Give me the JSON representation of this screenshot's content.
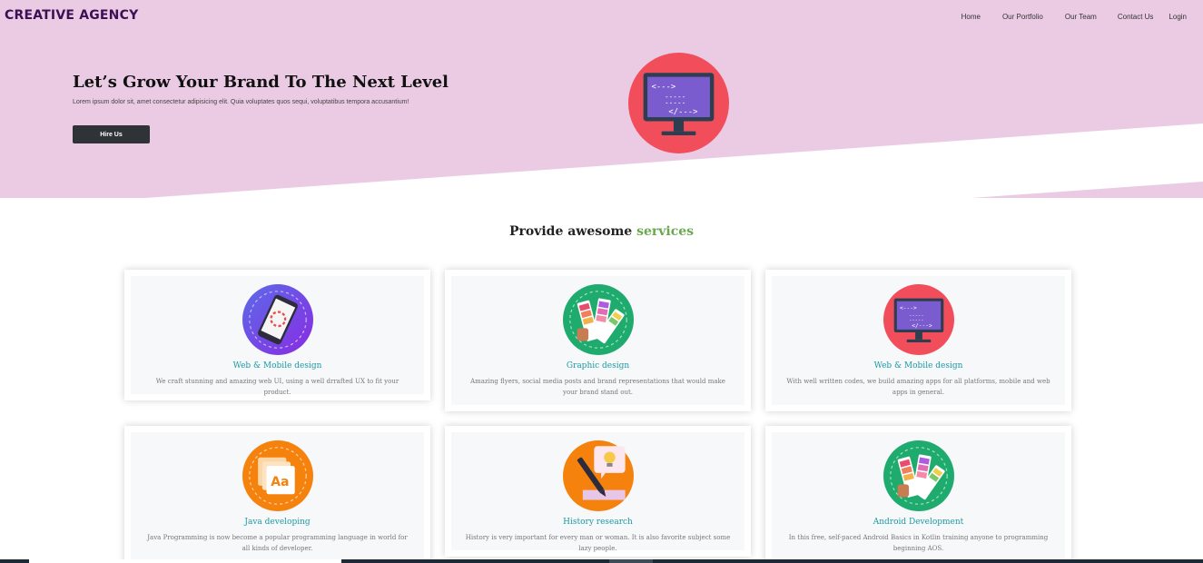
{
  "header": {
    "brand": "CREATIVE AGENCY",
    "nav": [
      "Home",
      "Our Portfolio",
      "Our Team",
      "Contact Us",
      "Login"
    ]
  },
  "hero": {
    "title": "Let’s Grow Your Brand To The Next Level",
    "text": "Lorem ipsum dolor sit, amet consectetur adipisicing elit. Quia voluptates quos sequi, voluptatibus tempora accusantium!",
    "button": "Hire Us",
    "image_icon": "monitor-code-icon"
  },
  "services": {
    "title": "Provide awesome",
    "title_accent": "services",
    "items": [
      {
        "title": "Web & Mobile design",
        "desc": "We craft stunning and amazing web UI, using a well drrafted UX to fit your product.",
        "icon": "mobile-phone-icon"
      },
      {
        "title": "Graphic design",
        "desc": "Amazing flyers, social media posts and brand representations that would make your brand stand out.",
        "icon": "color-palette-icon"
      },
      {
        "title": "Web & Mobile design",
        "desc": "With well written codes, we build amazing apps for all platforms, mobile and web apps in general.",
        "icon": "monitor-code-icon"
      },
      {
        "title": "Java developing",
        "desc": "Java Programming is now become a popular programming language in world for all kinds of developer.",
        "icon": "font-files-icon"
      },
      {
        "title": "History research",
        "desc": "History is very important for every man or woman. It is also favorite subject some lazy people.",
        "icon": "pen-idea-icon"
      },
      {
        "title": "Android Development",
        "desc": "In this free, self-paced Android Basics in Kotlin training anyone to programming beginning AOS.",
        "icon": "color-palette-icon"
      }
    ]
  },
  "colors": {
    "hero_bg": "#ebcbe4",
    "brand": "#3d0f55",
    "accent_green": "#6aa84f",
    "card_title": "#1a9aa3",
    "button_bg": "#2f3338"
  }
}
